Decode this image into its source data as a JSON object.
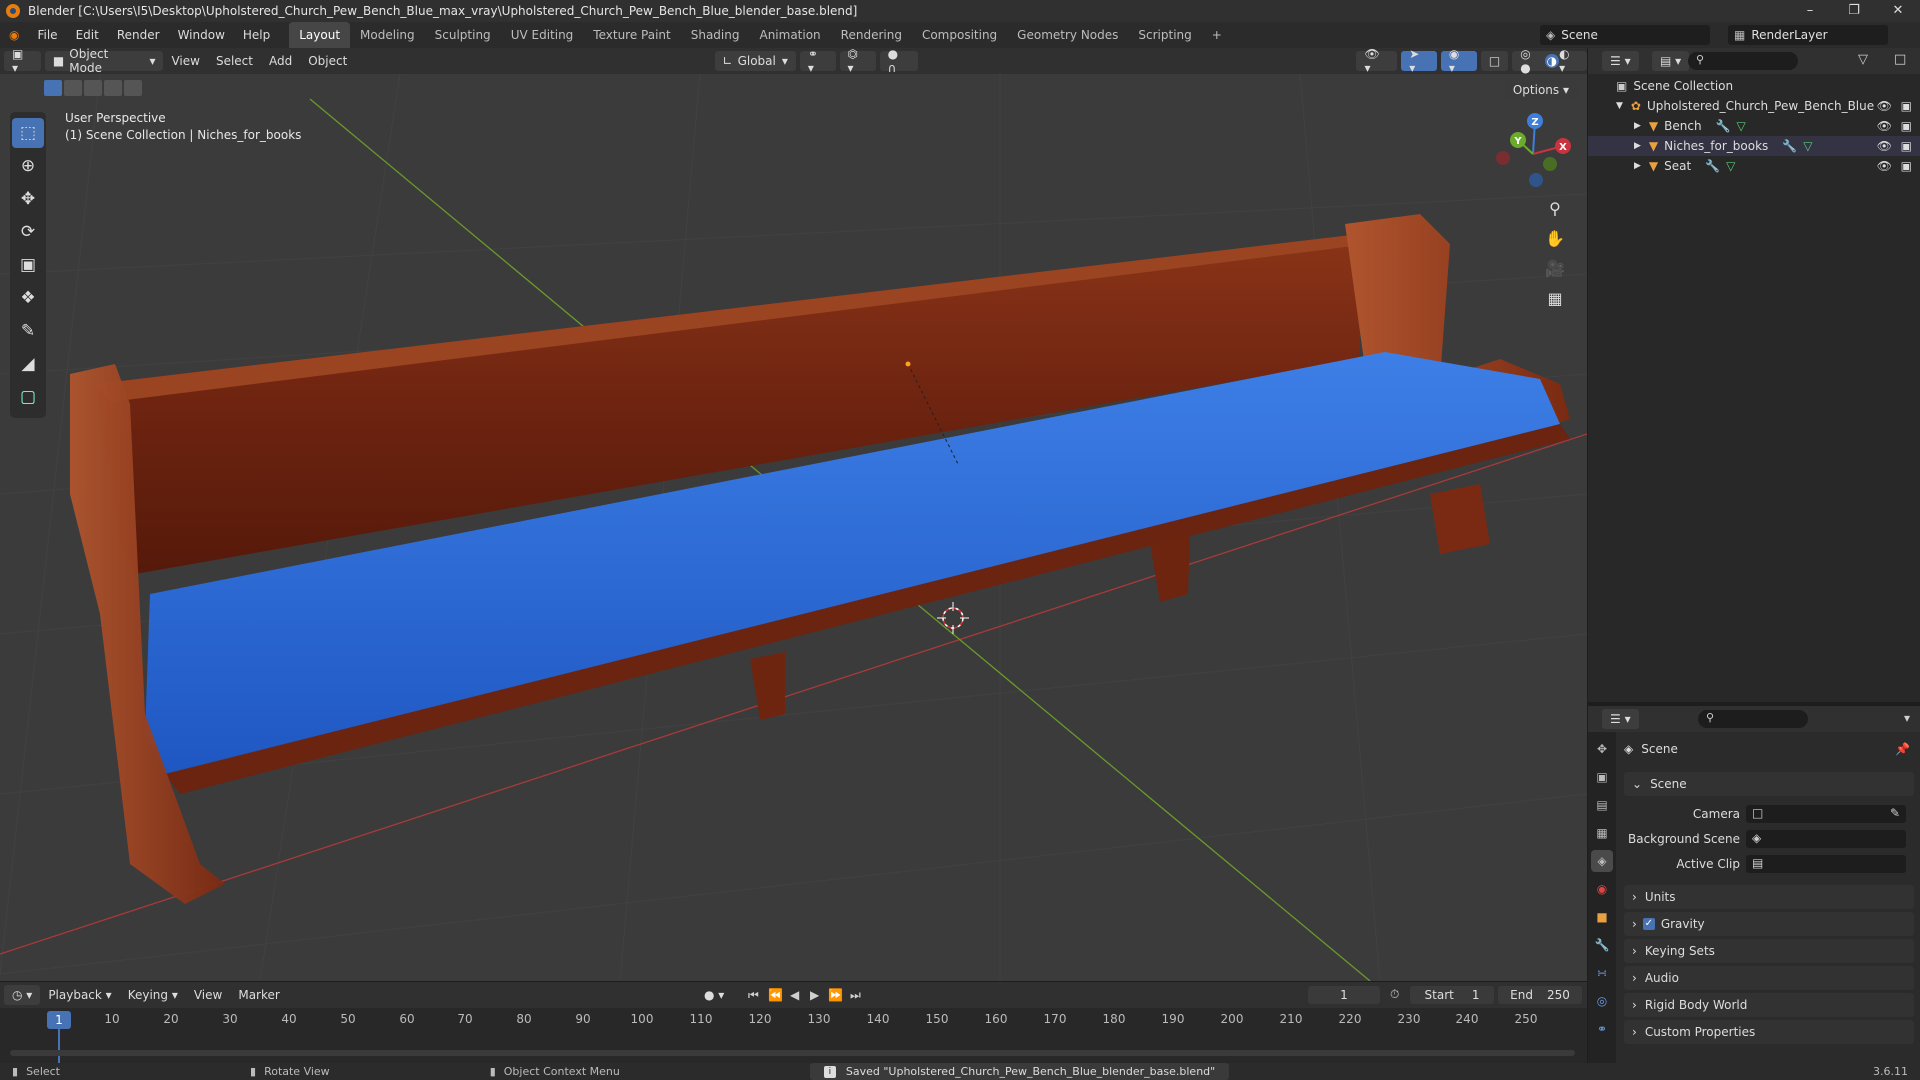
{
  "window": {
    "title": "Blender [C:\\Users\\I5\\Desktop\\Upholstered_Church_Pew_Bench_Blue_max_vray\\Upholstered_Church_Pew_Bench_Blue_blender_base.blend]"
  },
  "menu": [
    "File",
    "Edit",
    "Render",
    "Window",
    "Help"
  ],
  "workspaces": [
    "Layout",
    "Modeling",
    "Sculpting",
    "UV Editing",
    "Texture Paint",
    "Shading",
    "Animation",
    "Rendering",
    "Compositing",
    "Geometry Nodes",
    "Scripting"
  ],
  "add_workspace": "+",
  "scene_name": "Scene",
  "render_layer": "RenderLayer",
  "viewport": {
    "mode": "Object Mode",
    "menus": [
      "View",
      "Select",
      "Add",
      "Object"
    ],
    "orientation": "Global",
    "options": "Options",
    "info_line1": "User Perspective",
    "info_line2": "(1) Scene Collection | Niches_for_books",
    "gizmo_x": "X",
    "gizmo_y": "Y",
    "gizmo_z": "Z"
  },
  "outliner": {
    "root": "Scene Collection",
    "collection": "Upholstered_Church_Pew_Bench_Blue",
    "items": [
      "Bench",
      "Niches_for_books",
      "Seat"
    ]
  },
  "properties": {
    "title": "Scene",
    "section": "Scene",
    "camera_label": "Camera",
    "bg_scene_label": "Background Scene",
    "active_clip_label": "Active Clip",
    "panels": [
      "Units",
      "Gravity",
      "Keying Sets",
      "Audio",
      "Rigid Body World",
      "Custom Properties"
    ]
  },
  "timeline": {
    "menus": [
      "Playback",
      "Keying",
      "View",
      "Marker"
    ],
    "current_frame": "1",
    "start_label": "Start",
    "start": "1",
    "end_label": "End",
    "end": "250",
    "ticks": [
      "1",
      "10",
      "20",
      "30",
      "40",
      "50",
      "60",
      "70",
      "80",
      "90",
      "100",
      "110",
      "120",
      "130",
      "140",
      "150",
      "160",
      "170",
      "180",
      "190",
      "200",
      "210",
      "220",
      "230",
      "240",
      "250"
    ]
  },
  "status": {
    "select": "Select",
    "rotate": "Rotate View",
    "context": "Object Context Menu",
    "message": "Saved \"Upholstered_Church_Pew_Bench_Blue_blender_base.blend\"",
    "version": "3.6.11"
  },
  "colors": {
    "accent": "#4772b3",
    "wood": "#7a2a14",
    "seat": "#2f6fd6",
    "x_axis": "#c8333f",
    "y_axis": "#6bab2b",
    "z_axis": "#3f7fdc"
  }
}
